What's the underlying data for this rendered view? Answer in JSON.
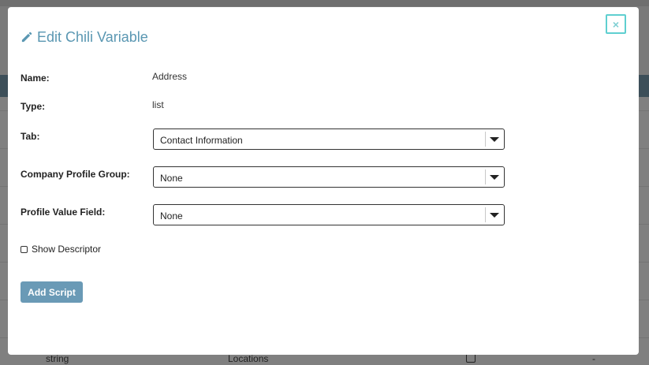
{
  "modal": {
    "title": "Edit Chili Variable",
    "close_label": "×",
    "fields": {
      "name_label": "Name:",
      "name_value": "Address",
      "type_label": "Type:",
      "type_value": "list",
      "tab_label": "Tab:",
      "tab_value": "Contact Information",
      "company_profile_group_label": "Company Profile Group:",
      "company_profile_group_value": "None",
      "profile_value_field_label": "Profile Value Field:",
      "profile_value_field_value": "None"
    },
    "show_descriptor_label": "Show Descriptor",
    "show_descriptor_checked": false,
    "add_script_label": "Add Script"
  },
  "background": {
    "row": {
      "type": "string",
      "name": "Locations",
      "dash": "-"
    }
  },
  "colors": {
    "title": "#5a97b2",
    "close_border": "#5fcfd0",
    "button": "#6a9ab6",
    "header_band": "#3d4f59"
  },
  "icons": {
    "title_icon": "pencil-icon",
    "close_icon": "close-icon",
    "dropdown_icon": "caret-down-icon"
  }
}
